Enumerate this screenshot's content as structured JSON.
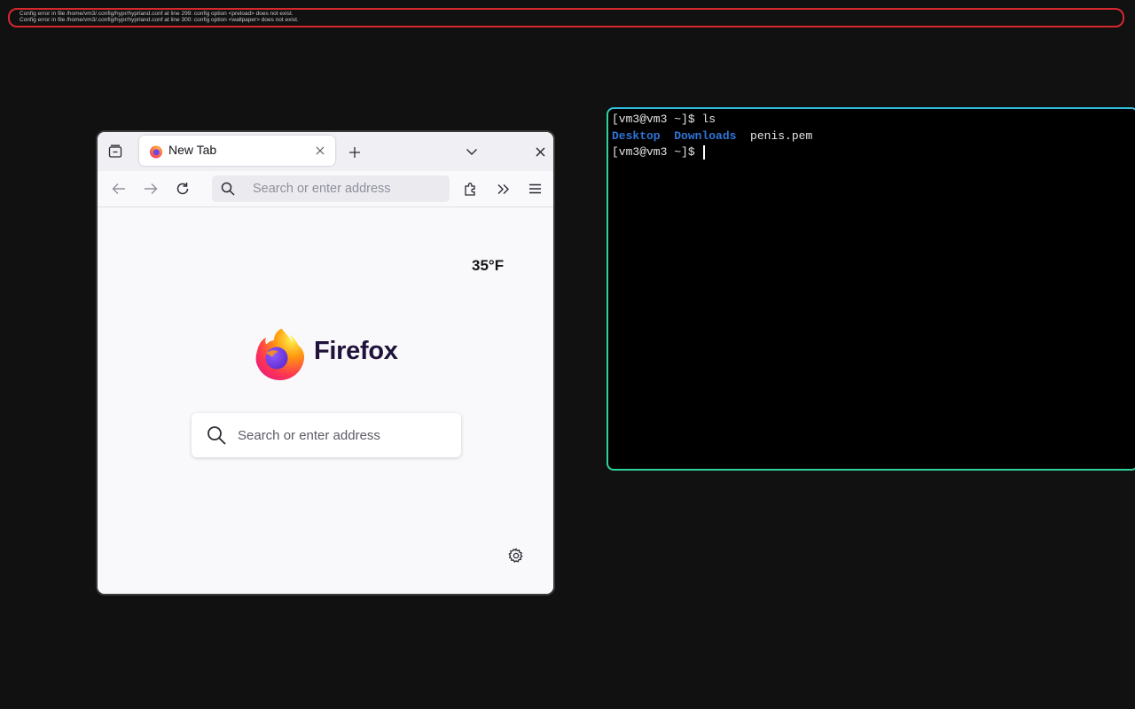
{
  "error_banner": {
    "lines": [
      "Config error in file /home/vm3/.config/hypr/hyprland.conf at line 299: config option <preload> does not exist.",
      "Config error in file /home/vm3/.config/hypr/hyprland.conf at line 300: config option <wallpaper> does not exist."
    ],
    "border_color": "#d4282f"
  },
  "firefox": {
    "tab": {
      "title": "New Tab"
    },
    "toolbar": {
      "url_placeholder": "Search or enter address"
    },
    "newtab": {
      "weather": "35°F",
      "wordmark": "Firefox",
      "search_placeholder": "Search or enter address"
    },
    "icons": [
      "tab-overview-icon",
      "firefox-favicon",
      "close-tab-icon",
      "new-tab-icon",
      "list-tabs-icon",
      "close-window-icon",
      "back-icon",
      "forward-icon",
      "reload-icon",
      "search-icon",
      "extensions-icon",
      "overflow-icon",
      "menu-icon",
      "settings-gear-icon"
    ]
  },
  "terminal": {
    "prompt": "[vm3@vm3 ~]$",
    "command": "ls",
    "listing": {
      "dir1": "Desktop",
      "dir2": "Downloads",
      "file1": "penis.pem"
    },
    "directory_color": "#2f74d6"
  }
}
